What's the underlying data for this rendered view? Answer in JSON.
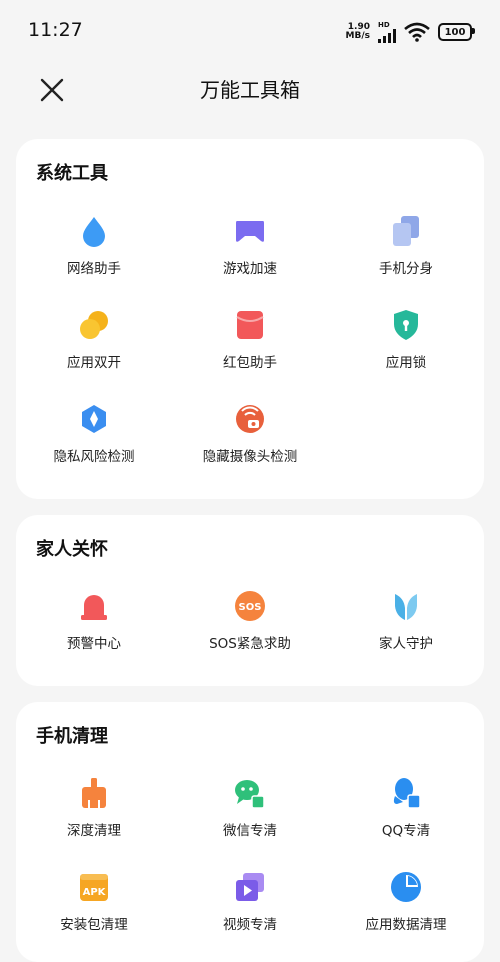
{
  "status": {
    "time": "11:27",
    "net_speed_value": "1.90",
    "net_speed_unit": "MB/s",
    "network_label": "HD",
    "battery": "100"
  },
  "header": {
    "title": "万能工具箱"
  },
  "sections": [
    {
      "title": "系统工具",
      "items": [
        {
          "label": "网络助手",
          "icon": "droplet-icon"
        },
        {
          "label": "游戏加速",
          "icon": "gamepad-icon"
        },
        {
          "label": "手机分身",
          "icon": "clone-icon"
        },
        {
          "label": "应用双开",
          "icon": "dual-coins-icon"
        },
        {
          "label": "红包助手",
          "icon": "red-envelope-icon"
        },
        {
          "label": "应用锁",
          "icon": "shield-lock-icon"
        },
        {
          "label": "隐私风险检测",
          "icon": "privacy-scan-icon"
        },
        {
          "label": "隐藏摄像头检测",
          "icon": "camera-detect-icon"
        }
      ]
    },
    {
      "title": "家人关怀",
      "items": [
        {
          "label": "预警中心",
          "icon": "alarm-light-icon"
        },
        {
          "label": "SOS紧急求助",
          "icon": "sos-icon",
          "icon_text": "SOS"
        },
        {
          "label": "家人守护",
          "icon": "family-guard-icon"
        }
      ]
    },
    {
      "title": "手机清理",
      "items": [
        {
          "label": "深度清理",
          "icon": "broom-icon"
        },
        {
          "label": "微信专清",
          "icon": "wechat-clean-icon"
        },
        {
          "label": "QQ专清",
          "icon": "qq-clean-icon"
        },
        {
          "label": "安装包清理",
          "icon": "apk-clean-icon",
          "icon_text": "APK"
        },
        {
          "label": "视频专清",
          "icon": "video-clean-icon"
        },
        {
          "label": "应用数据清理",
          "icon": "pie-chart-icon"
        }
      ]
    }
  ]
}
